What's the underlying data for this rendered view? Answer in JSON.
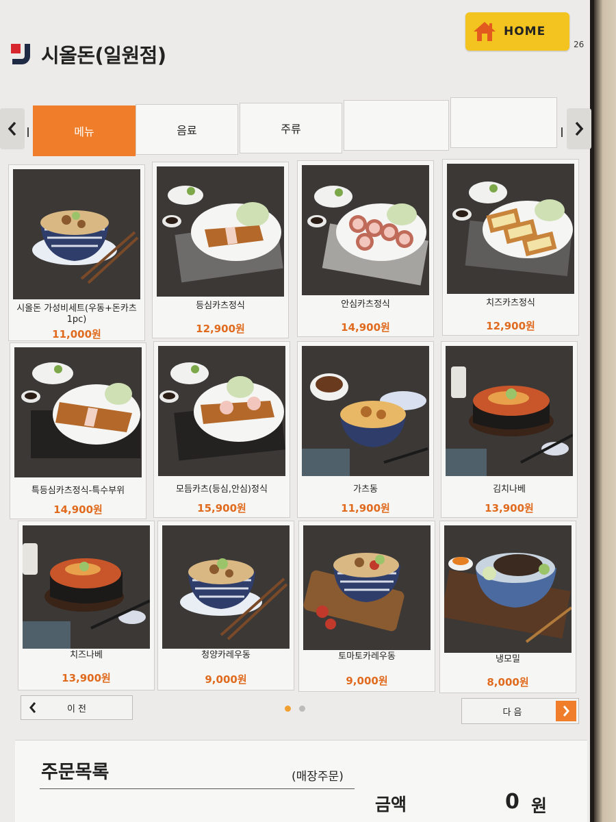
{
  "header": {
    "store_name": "시올돈(일원점)",
    "home_label": "HOME",
    "counter": "26"
  },
  "tabs": [
    {
      "label": "메뉴",
      "active": true
    },
    {
      "label": "음료",
      "active": false
    },
    {
      "label": "주류",
      "active": false
    },
    {
      "label": "",
      "active": false
    },
    {
      "label": "",
      "active": false
    }
  ],
  "menu_items": [
    {
      "name": "시올돈 가성비세트(우동+돈카츠1pc)",
      "price": "11,000원",
      "photo": "udon-bowl"
    },
    {
      "name": "등심카츠정식",
      "price": "12,900원",
      "photo": "katsu-plate"
    },
    {
      "name": "안심카츠정식",
      "price": "14,900원",
      "photo": "katsu-plate"
    },
    {
      "name": "치즈카츠정식",
      "price": "12,900원",
      "photo": "cheese-katsu-plate"
    },
    {
      "name": "특등심카츠정식-특수부위",
      "price": "14,900원",
      "photo": "katsu-plate"
    },
    {
      "name": "모듬카츠(등심,안심)정식",
      "price": "15,900원",
      "photo": "katsu-plate"
    },
    {
      "name": "가츠동",
      "price": "11,900원",
      "photo": "katsudon-bowl"
    },
    {
      "name": "김치나베",
      "price": "13,900원",
      "photo": "nabe-pot"
    },
    {
      "name": "치즈나베",
      "price": "13,900원",
      "photo": "nabe-pot"
    },
    {
      "name": "청양카레우동",
      "price": "9,000원",
      "photo": "udon-bowl"
    },
    {
      "name": "토마토카레우동",
      "price": "9,000원",
      "photo": "udon-bowl"
    },
    {
      "name": "냉모밀",
      "price": "8,000원",
      "photo": "soba-bowl"
    }
  ],
  "pager": {
    "prev_label": "이 전",
    "next_label": "다 음",
    "current_page": 1,
    "total_pages": 2
  },
  "order": {
    "title": "주문목록",
    "type": "(매장주문)",
    "amount_label": "금액",
    "amount_value": "0",
    "amount_unit": "원"
  },
  "colors": {
    "accent": "#f07d2a",
    "home_button": "#f3c41f",
    "price": "#e06a1e"
  }
}
